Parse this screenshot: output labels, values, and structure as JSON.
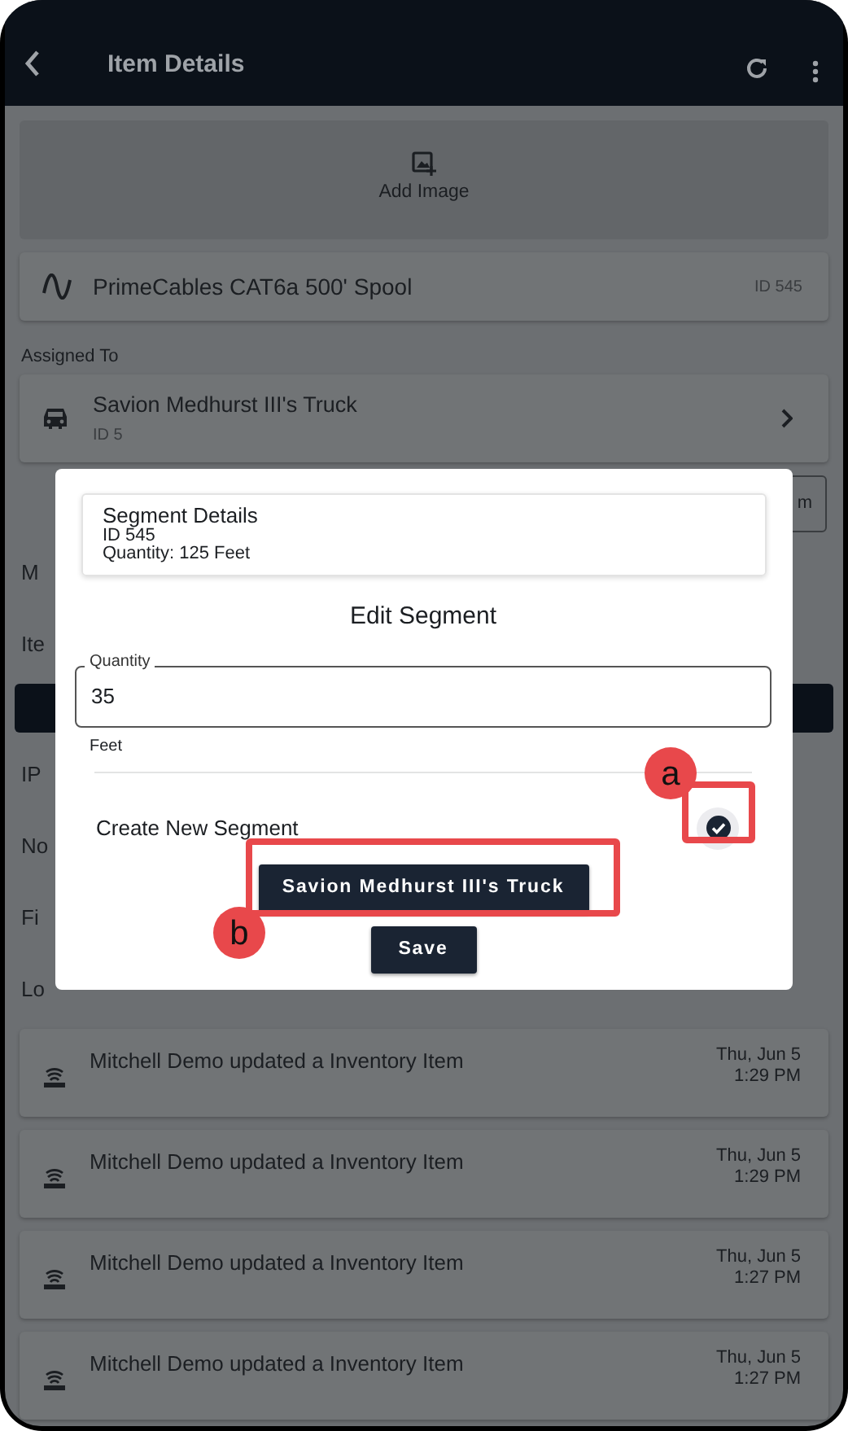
{
  "header": {
    "title": "Item Details"
  },
  "add_image": {
    "label": "Add Image"
  },
  "item": {
    "name": "PrimeCables CAT6a 500' Spool",
    "id": "ID 545"
  },
  "assigned_to": {
    "label": "Assigned To",
    "name": "Savion Medhurst III's Truck",
    "id": "ID 5"
  },
  "partial_button": "m",
  "partial_rows": [
    {
      "kind": "label",
      "text": "M"
    },
    {
      "kind": "label",
      "text": "Ite"
    },
    {
      "kind": "bar"
    },
    {
      "kind": "label",
      "text": "IP"
    },
    {
      "kind": "label",
      "text": "No"
    },
    {
      "kind": "label",
      "text": "Fi"
    },
    {
      "kind": "label",
      "text": "Lo"
    }
  ],
  "logs": [
    {
      "text": "Mitchell Demo updated a Inventory Item",
      "date": "Thu, Jun 5",
      "time": "1:29 PM"
    },
    {
      "text": "Mitchell Demo updated a Inventory Item",
      "date": "Thu, Jun 5",
      "time": "1:29 PM"
    },
    {
      "text": "Mitchell Demo updated a Inventory Item",
      "date": "Thu, Jun 5",
      "time": "1:27 PM"
    },
    {
      "text": "Mitchell Demo updated a Inventory Item",
      "date": "Thu, Jun 5",
      "time": "1:27 PM"
    }
  ],
  "modal": {
    "details": {
      "title": "Segment Details",
      "id": "ID 545",
      "quantity": "Quantity: 125 Feet"
    },
    "title": "Edit Segment",
    "quantity_field": {
      "label": "Quantity",
      "value": "35",
      "unit": "Feet"
    },
    "create_new": {
      "label": "Create New Segment",
      "checked": true
    },
    "assign_button": "Savion Medhurst III's Truck",
    "save_button": "Save"
  },
  "callouts": [
    {
      "label": "a"
    },
    {
      "label": "b"
    }
  ]
}
